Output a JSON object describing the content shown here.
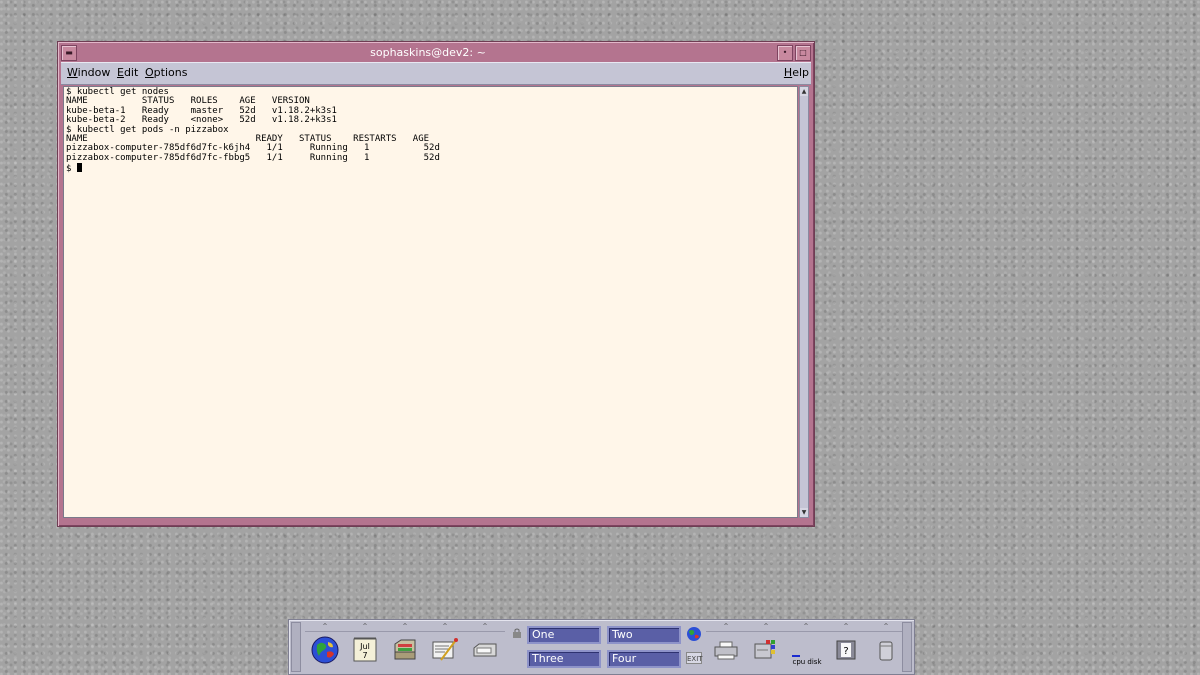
{
  "window": {
    "title": "sophaskins@dev2: ~",
    "menu": {
      "window": "Window",
      "edit": "Edit",
      "options": "Options",
      "help": "Help"
    },
    "terminal_lines": [
      "$ kubectl get nodes",
      "NAME          STATUS   ROLES    AGE   VERSION",
      "kube-beta-1   Ready    master   52d   v1.18.2+k3s1",
      "kube-beta-2   Ready    <none>   52d   v1.18.2+k3s1",
      "$ kubectl get pods -n pizzabox",
      "NAME                               READY   STATUS    RESTARTS   AGE",
      "pizzabox-computer-785df6d7fc-k6jh4   1/1     Running   1          52d",
      "pizzabox-computer-785df6d7fc-fbbg5   1/1     Running   1          52d"
    ],
    "prompt": "$ "
  },
  "front_panel": {
    "calendar": {
      "month": "Jul",
      "day": "7"
    },
    "workspaces": {
      "one": "One",
      "two": "Two",
      "three": "Three",
      "four": "Four"
    },
    "exit_label": "EXIT",
    "meter_label": "cpu disk"
  },
  "colors": {
    "titlebar": "#b4748f",
    "terminal_bg": "#fff6e9",
    "menubar": "#c5c5d5",
    "workspace_button": "#5a5fa6",
    "desktop": "#a3a3a3"
  }
}
